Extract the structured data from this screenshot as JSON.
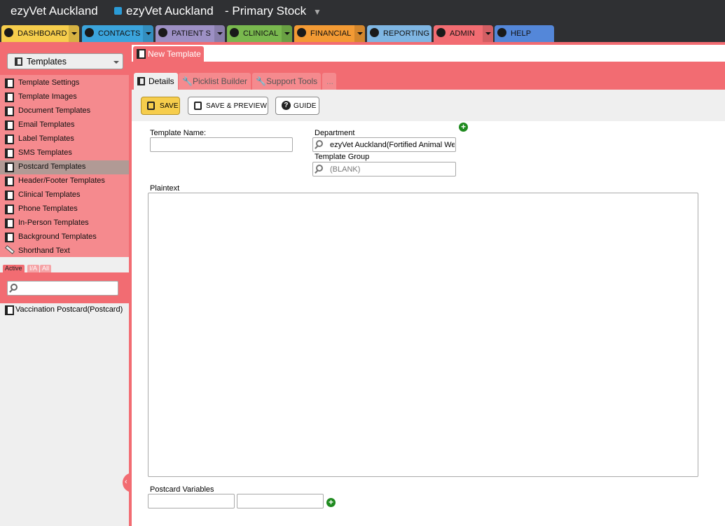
{
  "header": {
    "app_name": "ezyVet Auckland",
    "site_name": "ezyVet Auckland",
    "stock_location": "- Primary Stock"
  },
  "nav": [
    {
      "label": "DASHBOARD",
      "color": "#f6cd4c",
      "icon": "dashboard-icon"
    },
    {
      "label": "CONTACTS",
      "color": "#3ba4dc",
      "icon": "contacts-icon"
    },
    {
      "label": "PATIENT S",
      "color": "#9d90c4",
      "icon": "paw-icon"
    },
    {
      "label": "CLINICAL",
      "color": "#79b84e",
      "icon": "caduceus-icon"
    },
    {
      "label": "FINANCIAL",
      "color": "#f39a34",
      "icon": "money-bag-icon"
    },
    {
      "label": "REPORTING",
      "color": "#7fb6e3",
      "icon": "chart-icon"
    },
    {
      "label": "ADMIN",
      "color": "#f26c72",
      "icon": "gear-icon"
    },
    {
      "label": "HELP",
      "color": "#5487d9",
      "icon": "question-icon"
    }
  ],
  "sidebar": {
    "module": "Templates",
    "items": [
      {
        "label": "Template Settings",
        "active": false
      },
      {
        "label": "Template Images",
        "active": false
      },
      {
        "label": "Document Templates",
        "active": false
      },
      {
        "label": "Email Templates",
        "active": false
      },
      {
        "label": "Label Templates",
        "active": false
      },
      {
        "label": "SMS Templates",
        "active": false
      },
      {
        "label": "Postcard Templates",
        "active": true
      },
      {
        "label": "Header/Footer Templates",
        "active": false
      },
      {
        "label": "Clinical Templates",
        "active": false
      },
      {
        "label": "Phone Templates",
        "active": false
      },
      {
        "label": "In-Person Templates",
        "active": false
      },
      {
        "label": "Background Templates",
        "active": false
      },
      {
        "label": "Shorthand Text",
        "active": false
      }
    ],
    "filters": [
      "Active",
      "I/A",
      "All"
    ],
    "search_value": "",
    "results": [
      "Vaccination Postcard(Postcard)"
    ]
  },
  "record": {
    "title": "New Template",
    "subtabs": [
      "Details",
      "Picklist Builder",
      "Support Tools",
      "..."
    ],
    "buttons": {
      "save": "SAVE",
      "preview": "SAVE & PREVIEW",
      "guide": "GUIDE"
    }
  },
  "form": {
    "template_name_label": "Template Name:",
    "template_name_value": "",
    "department_label": "Department",
    "department_value": "ezyVet Auckland(Fortified Animal We",
    "template_group_label": "Template Group",
    "template_group_value": "(BLANK)",
    "plaintext_label": "Plaintext",
    "plaintext_value": "",
    "postcard_variables_label": "Postcard Variables"
  }
}
